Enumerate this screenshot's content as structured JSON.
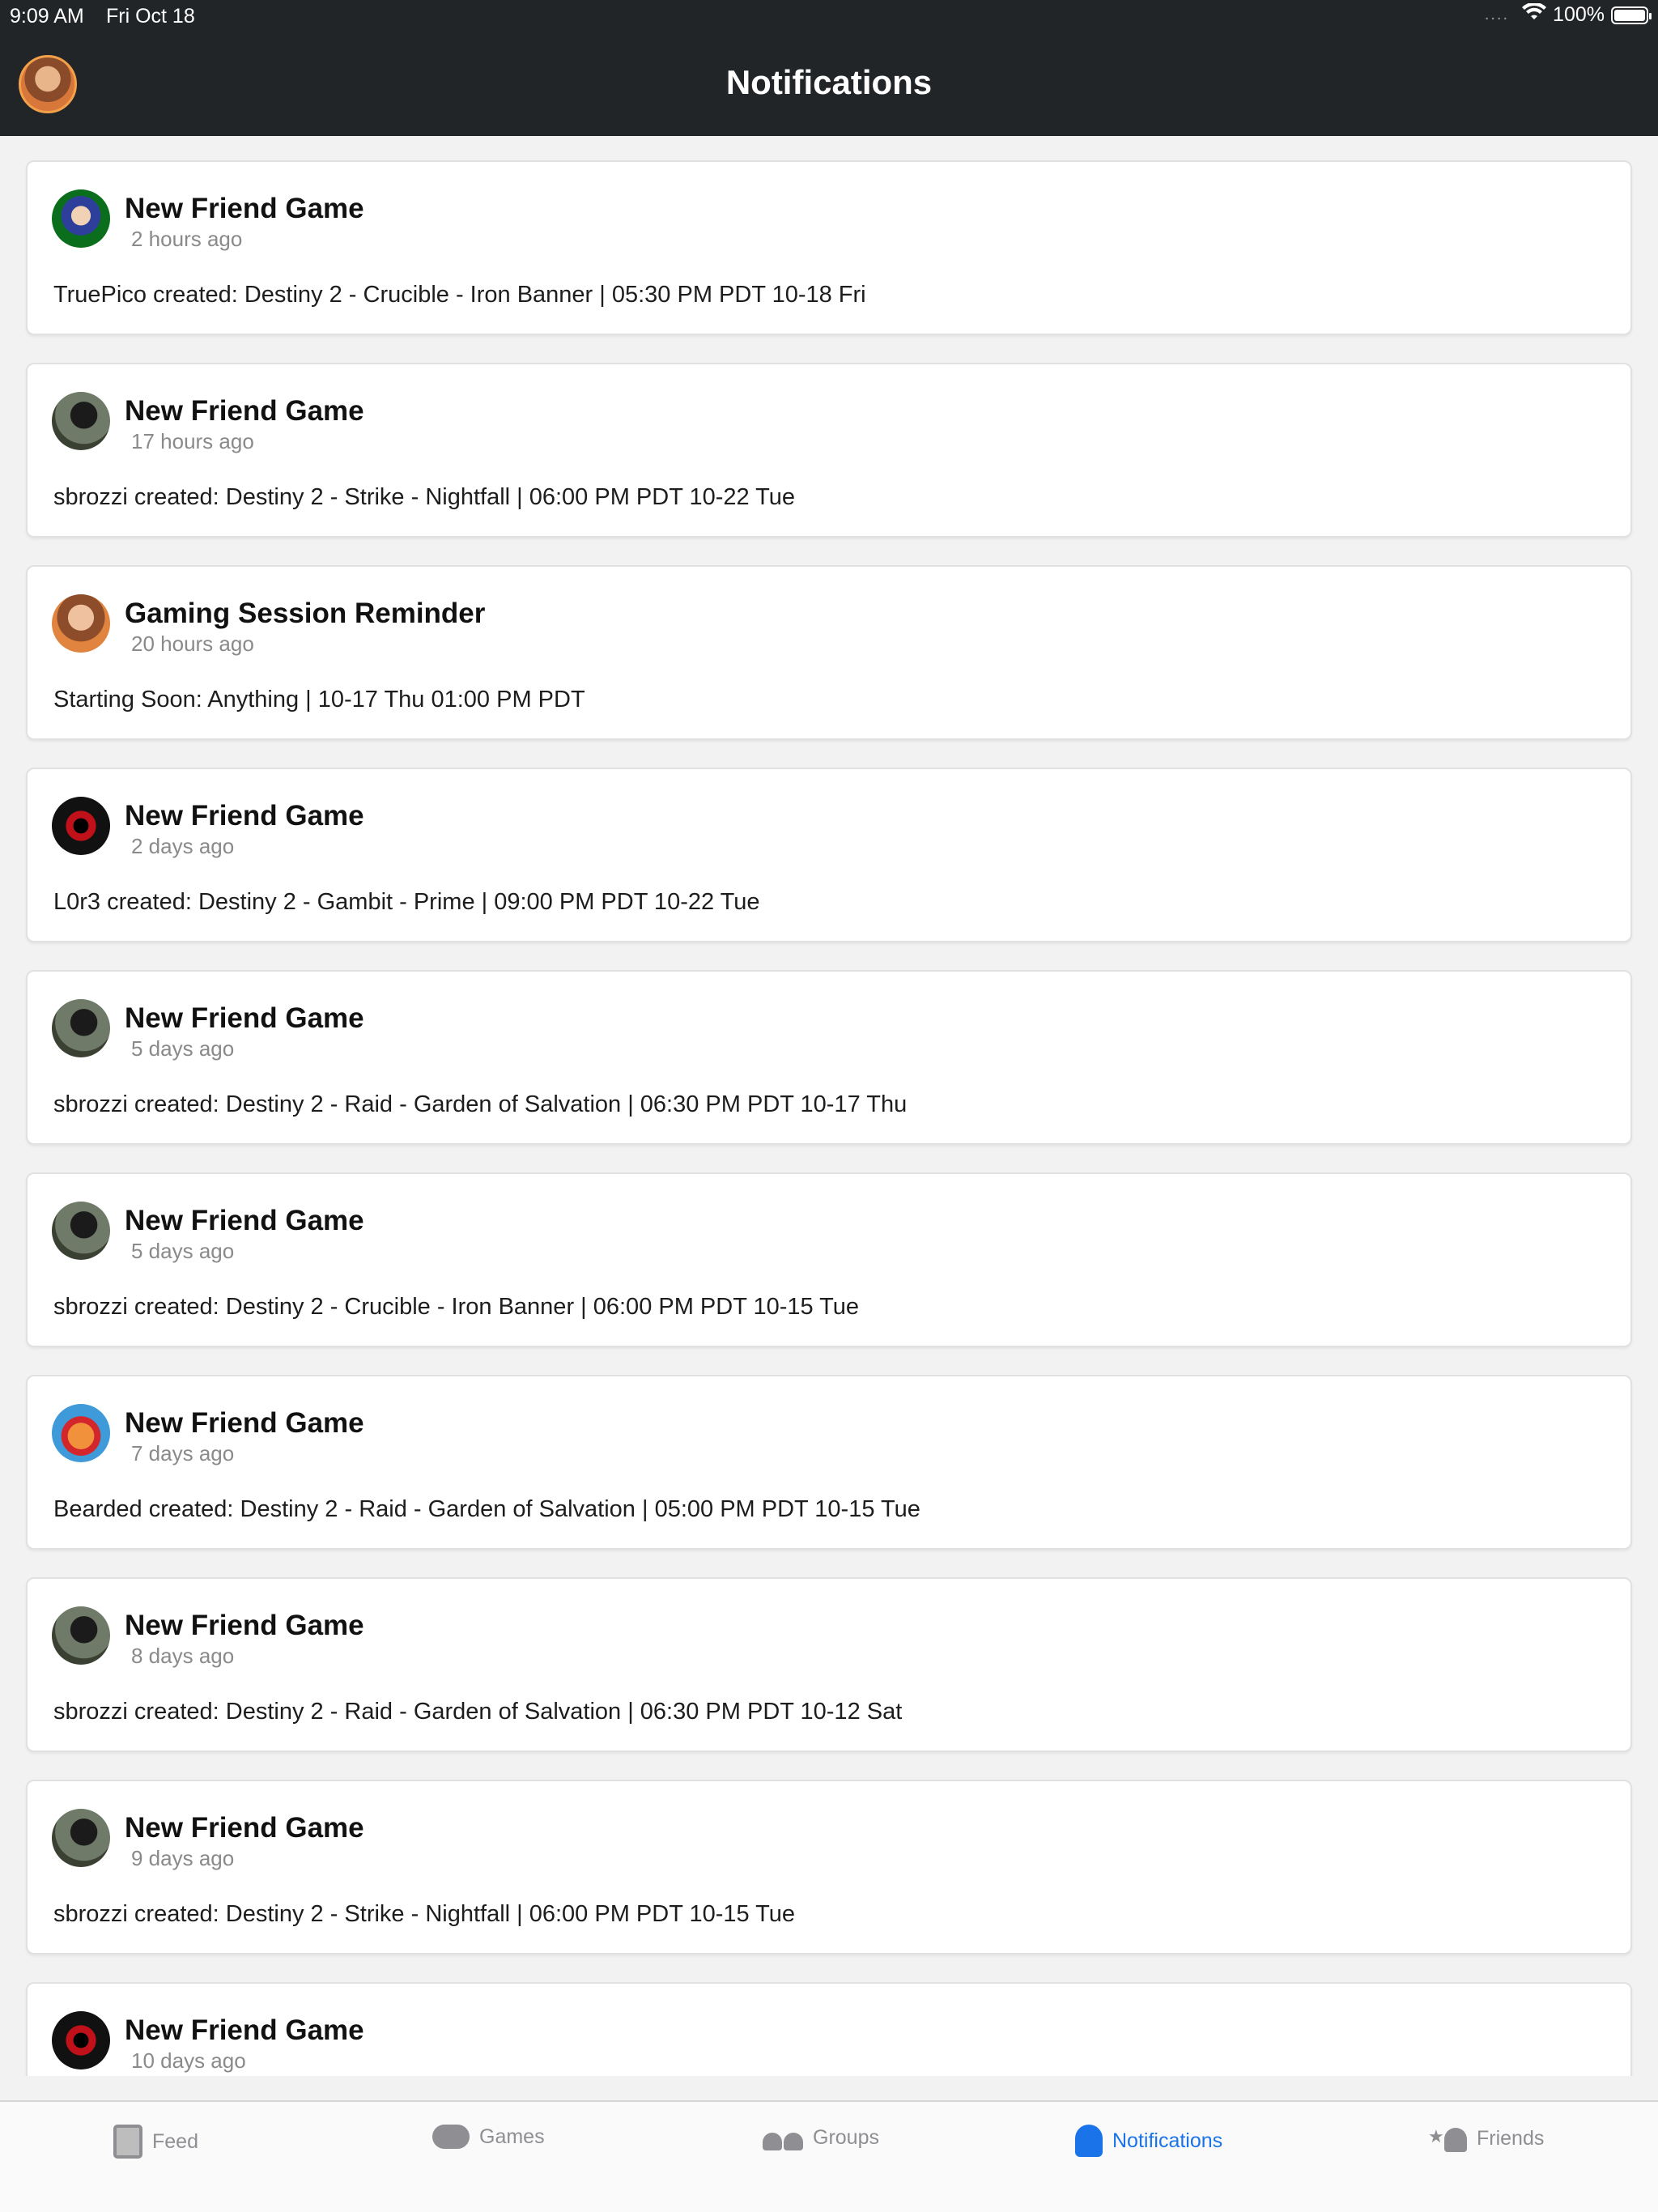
{
  "status_bar": {
    "time": "9:09 AM",
    "date": "Fri Oct 18",
    "signal": "....",
    "battery_label": "100%",
    "battery_level": 1.0
  },
  "header": {
    "title": "Notifications",
    "avatar_icon": "user-avatar"
  },
  "notifications": [
    {
      "title": "New Friend Game",
      "time": "2 hours ago",
      "body": "TruePico created: Destiny 2 - Crucible - Iron Banner | 05:30 PM PDT 10-18 Fri",
      "avatar": "truepico-avatar"
    },
    {
      "title": "New Friend Game",
      "time": "17 hours ago",
      "body": "sbrozzi created: Destiny 2 - Strike - Nightfall | 06:00 PM PDT 10-22 Tue",
      "avatar": "sbrozzi-avatar"
    },
    {
      "title": "Gaming Session Reminder",
      "time": "20 hours ago",
      "body": "Starting Soon: Anything | 10-17 Thu 01:00 PM PDT",
      "avatar": "self-avatar"
    },
    {
      "title": "New Friend Game",
      "time": "2 days ago",
      "body": "L0r3 created: Destiny 2 - Gambit - Prime | 09:00 PM PDT 10-22 Tue",
      "avatar": "l0r3-avatar"
    },
    {
      "title": "New Friend Game",
      "time": "5 days ago",
      "body": "sbrozzi created: Destiny 2 - Raid - Garden of Salvation | 06:30 PM PDT 10-17 Thu",
      "avatar": "sbrozzi-avatar"
    },
    {
      "title": "New Friend Game",
      "time": "5 days ago",
      "body": "sbrozzi created: Destiny 2 - Crucible - Iron Banner | 06:00 PM PDT 10-15 Tue",
      "avatar": "sbrozzi-avatar"
    },
    {
      "title": "New Friend Game",
      "time": "7 days ago",
      "body": "Bearded created: Destiny 2 - Raid - Garden of Salvation | 05:00 PM PDT 10-15 Tue",
      "avatar": "bearded-avatar"
    },
    {
      "title": "New Friend Game",
      "time": "8 days ago",
      "body": "sbrozzi created: Destiny 2 - Raid - Garden of Salvation | 06:30 PM PDT 10-12 Sat",
      "avatar": "sbrozzi-avatar"
    },
    {
      "title": "New Friend Game",
      "time": "9 days ago",
      "body": "sbrozzi created: Destiny 2 - Strike - Nightfall | 06:00 PM PDT 10-15 Tue",
      "avatar": "sbrozzi-avatar"
    },
    {
      "title": "New Friend Game",
      "time": "10 days ago",
      "body": "",
      "avatar": "l0r3-avatar"
    }
  ],
  "tabs": [
    {
      "label": "Feed",
      "icon": "feed-icon",
      "active": false
    },
    {
      "label": "Games",
      "icon": "gamepad-icon",
      "active": false
    },
    {
      "label": "Groups",
      "icon": "groups-icon",
      "active": false
    },
    {
      "label": "Notifications",
      "icon": "bell-icon",
      "active": true
    },
    {
      "label": "Friends",
      "icon": "friends-icon",
      "active": false
    }
  ],
  "colors": {
    "header_bg": "#222527",
    "accent": "#1a73e8",
    "tab_inactive": "#8e8e93"
  }
}
